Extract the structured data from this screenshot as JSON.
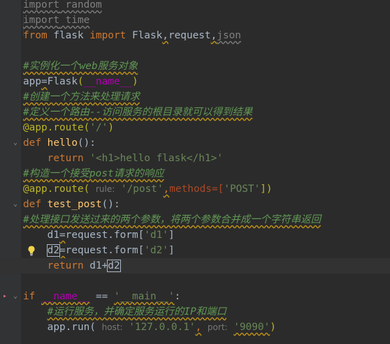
{
  "code": {
    "l1_kw": "import",
    "l1_mod": " random",
    "l2_kw": "import",
    "l2_mod": " time",
    "l3_from": "from",
    "l3_mod": " flask ",
    "l3_import": "import",
    "l3_flask": " Flask",
    "l3_c1": ",",
    "l3_request": "request",
    "l3_c2": ",",
    "l3_json": "json",
    "l5_cmt": "#实例化一个web服务对象",
    "l6_app": "app",
    "l6_eq": "=",
    "l6_flask": "Flask",
    "l6_open": "(",
    "l6_name": "__name__",
    "l6_close": ")",
    "l7_cmt": "#创建一个方法来处理请求",
    "l8_cmt": "#定义一个路由--访问服务的根目录就可以得到结果",
    "l9_deco": "@app.route(",
    "l9_str": "'/'",
    "l9_close": ")",
    "l10_def": "def",
    "l10_fn": " hello",
    "l10_rest": "():",
    "l11_ret": "return",
    "l11_str": " '<h1>hello flask</h1>'",
    "l12_cmt": "#构造一个接受post请求的响应",
    "l13_deco": "@app.route(",
    "l13_hint": "rule:",
    "l13_str": "'/post'",
    "l13_comma": ",",
    "l13_methods": "methods=[",
    "l13_post": "'POST'",
    "l13_close": "])",
    "l14_def": "def",
    "l14_fn": " test_post",
    "l14_rest": "():",
    "l15_cmt": "#处理接口发送过来的两个参数，将两个参数合并成一个字符串返回",
    "l16_d1": "d1",
    "l16_eq": "=",
    "l16_rest": "request.form[",
    "l16_str": "'d1'",
    "l16_close": "]",
    "l17_d2": "d2",
    "l17_eq": "=",
    "l17_rest": "request.form[",
    "l17_str": "'d2'",
    "l17_close": "]",
    "l18_ret": "return",
    "l18_mid": " d1+",
    "l18_d2": "d2",
    "l20_if": "if",
    "l20_name": "__name__",
    "l20_eq": " == ",
    "l20_str": "'__main__'",
    "l20_colon": ":",
    "l21_cmt": "#运行服务，并确定服务运行的IP和端口",
    "l22_app": "app.run(",
    "l22_hint1": "host:",
    "l22_str1": "'127.0.0.1'",
    "l22_comma": ",",
    "l22_hint2": "port:",
    "l22_str2": "'9090'",
    "l22_close": ")"
  },
  "icons": {
    "fold": "fold-arrow-icon",
    "bulb": "lightbulb-icon"
  },
  "colors": {
    "background": "#2b2b2b",
    "keyword": "#cc7832",
    "string": "#6a8759",
    "comment": "#629755",
    "text": "#a9b7c6"
  }
}
